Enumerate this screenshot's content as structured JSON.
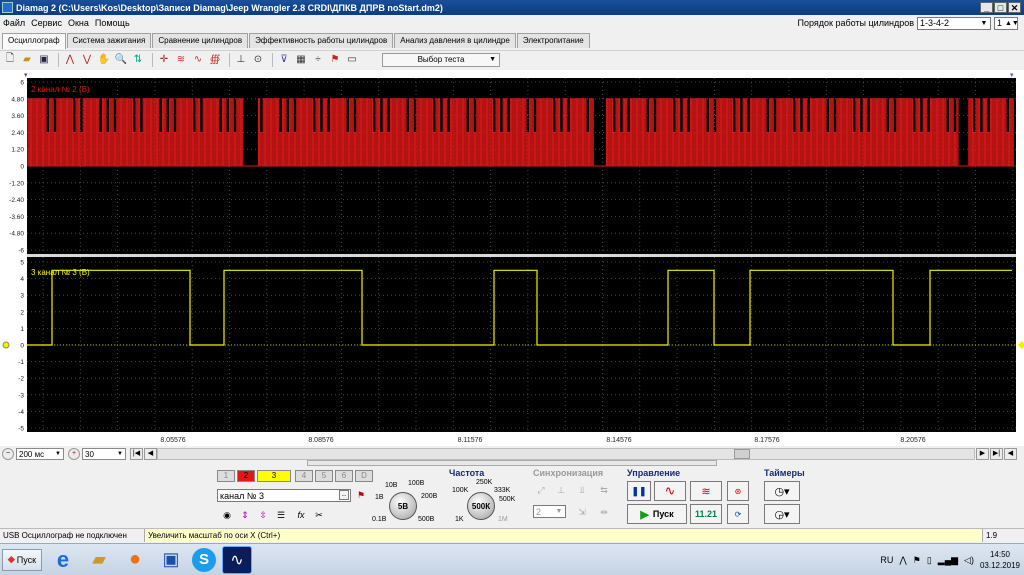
{
  "window": {
    "title": "Diamag 2 (C:\\Users\\Kos\\Desktop\\Записи Diamag\\Jeep Wrangler 2.8 CRDI\\ДПКВ ДПРВ noStart.dm2)",
    "min": "_",
    "max": "□",
    "close": "✕"
  },
  "menu": {
    "items": [
      "Файл",
      "Сервис",
      "Окна",
      "Помощь"
    ],
    "cyl_order_label": "Порядок работы цилиндров",
    "cyl_order_value": "1-3-4-2",
    "cyl_index_value": "1"
  },
  "tabs": [
    "Осциллограф",
    "Система зажигания",
    "Сравнение цилиндров",
    "Эффективность работы цилиндров",
    "Анализ давления в цилиндре",
    "Электропитание"
  ],
  "toolbar": {
    "test_select": "Выбор теста"
  },
  "scope": {
    "ch2_label": "2  канал № 2 (В)",
    "ch3_label": "3  канал № 3 (В)",
    "ch2_ticks": [
      "6",
      "4.80",
      "3.60",
      "2.40",
      "1.20",
      "0",
      "-1.20",
      "-2.40",
      "-3.60",
      "-4.80",
      "-6"
    ],
    "ch3_ticks": [
      "5",
      "4",
      "3",
      "2",
      "1",
      "0",
      "-1",
      "-2",
      "-3",
      "-4",
      "-5"
    ],
    "time_ticks": [
      "8.05576",
      "8.08576",
      "8.11576",
      "8.14576",
      "8.17576",
      "8.20576"
    ],
    "ch2_color": "#e11818",
    "ch3_color": "#f2f200",
    "bg_color": "#000000"
  },
  "hscroll": {
    "timebase": "200  мс",
    "scale": "30"
  },
  "panel": {
    "channels": [
      "1",
      "2",
      "3",
      "4",
      "5",
      "6",
      "D"
    ],
    "channel_name": "канал № 3",
    "volt_knob_value": "5В",
    "volt_labels": [
      "10В",
      "1В",
      "0.1В",
      "100В",
      "200В",
      "500В"
    ],
    "freq_title": "Частота",
    "freq_knob_value": "500К",
    "freq_labels": [
      "250K",
      "100K",
      "333K",
      "500K",
      "1K",
      "1M"
    ],
    "sync_title": "Синхронизация",
    "sync_value": "2",
    "control_title": "Управление",
    "start_label": "Пуск",
    "counter": "11.21",
    "timers_title": "Таймеры"
  },
  "status": {
    "device": "USB Осциллограф не подключен",
    "hint": "Увеличить масштаб по оси X (Ctrl+)",
    "version": "1.9"
  },
  "taskbar": {
    "start": "Пуск",
    "lang": "RU",
    "time": "14:50",
    "date": "03.12.2019"
  }
}
